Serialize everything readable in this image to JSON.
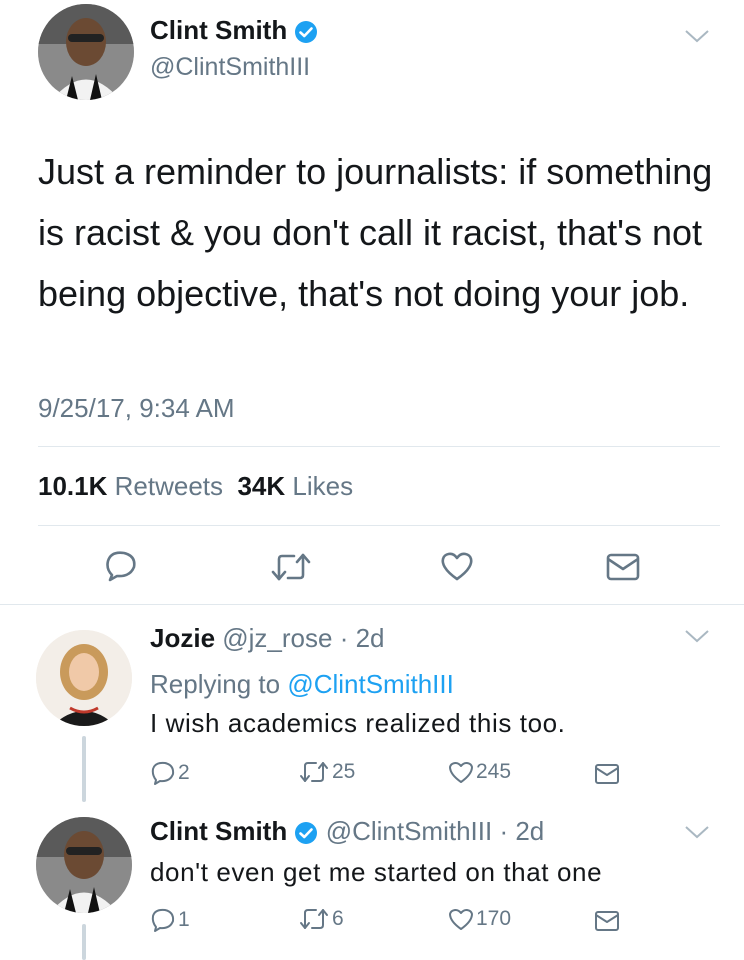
{
  "main_tweet": {
    "display_name": "Clint Smith",
    "handle": "@ClintSmithIII",
    "text": "Just a reminder to journalists: if something is racist & you don't call it racist, that's not being objective, that's not doing your job.",
    "timestamp": "9/25/17, 9:34 AM",
    "retweets_count": "10.1K",
    "retweets_label": "Retweets",
    "likes_count": "34K",
    "likes_label": "Likes",
    "verified": true
  },
  "replies": [
    {
      "display_name": "Jozie",
      "handle": "@jz_rose",
      "time": "2d",
      "replying_prefix": "Replying to",
      "replying_to": "@ClintSmithIII",
      "text": "I wish academics realized this too.",
      "reply_count": "2",
      "retweet_count": "25",
      "like_count": "245"
    },
    {
      "display_name": "Clint Smith",
      "handle": "@ClintSmithIII",
      "time": "2d",
      "text": "don't even get me started on that one",
      "reply_count": "1",
      "retweet_count": "6",
      "like_count": "170",
      "verified": true
    }
  ],
  "colors": {
    "accent": "#1da1f2",
    "secondary_text": "#657786",
    "icon": "#657786",
    "divider": "#e1e8ed"
  },
  "icons": [
    "reply-icon",
    "retweet-icon",
    "like-icon",
    "message-icon",
    "verified-badge-icon",
    "chevron-down-icon"
  ]
}
